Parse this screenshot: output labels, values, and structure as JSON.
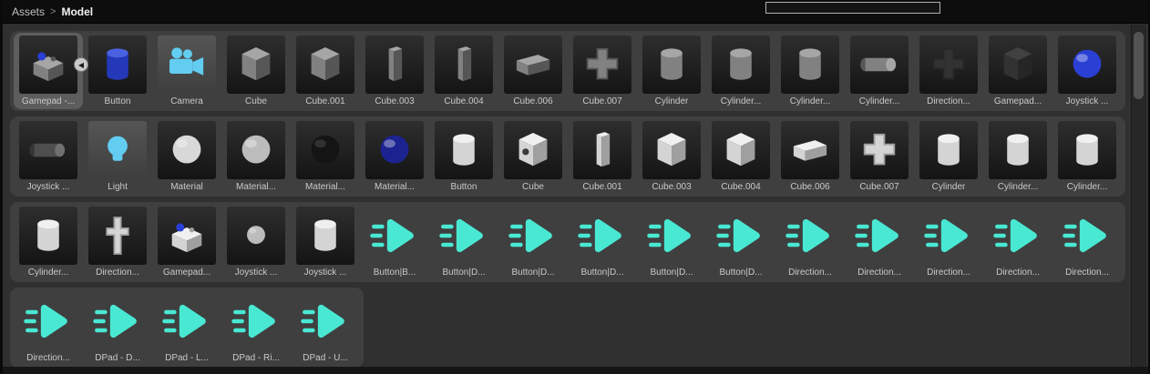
{
  "colors": {
    "accent_anim": "#49e8d3",
    "accent_cyan": "#63cdf1",
    "sphere_blue": "#2a3fd4",
    "selection": "#5d5d5d",
    "strip": "#3f3f3f",
    "page": "#303030",
    "header": "#0d0d0d",
    "label": "#c9c9c9"
  },
  "header": {
    "breadcrumb": [
      {
        "label": "Assets"
      },
      {
        "label": "Model"
      }
    ],
    "separator": ">",
    "search": {
      "value": "",
      "placeholder": ""
    }
  },
  "grid": {
    "rows": [
      {
        "items": [
          {
            "label": "Gamepad -...",
            "icon": "gamepad",
            "tone": "gray",
            "thumb": "dark",
            "selected": true,
            "badge": "◀"
          },
          {
            "label": "Button",
            "icon": "cylinder",
            "tone": "blue",
            "thumb": "dark"
          },
          {
            "label": "Camera",
            "icon": "camera",
            "thumb": "gray"
          },
          {
            "label": "Cube",
            "icon": "cube",
            "tone": "gray",
            "thumb": "dark"
          },
          {
            "label": "Cube.001",
            "icon": "cube",
            "tone": "gray",
            "thumb": "dark"
          },
          {
            "label": "Cube.003",
            "icon": "panel",
            "tone": "gray",
            "thumb": "dark"
          },
          {
            "label": "Cube.004",
            "icon": "panel",
            "tone": "gray",
            "thumb": "dark"
          },
          {
            "label": "Cube.006",
            "icon": "slab",
            "tone": "gray",
            "thumb": "dark"
          },
          {
            "label": "Cube.007",
            "icon": "cross",
            "tone": "gray",
            "thumb": "dark"
          },
          {
            "label": "Cylinder",
            "icon": "cylinder",
            "tone": "gray",
            "thumb": "dark"
          },
          {
            "label": "Cylinder...",
            "icon": "cylinder",
            "tone": "gray",
            "thumb": "dark"
          },
          {
            "label": "Cylinder...",
            "icon": "cylinder",
            "tone": "gray",
            "thumb": "dark"
          },
          {
            "label": "Cylinder...",
            "icon": "cylinder-h",
            "tone": "gray",
            "thumb": "dark"
          },
          {
            "label": "Direction...",
            "icon": "cross",
            "tone": "dark",
            "thumb": "dark"
          },
          {
            "label": "Gamepad...",
            "icon": "cube",
            "tone": "dark",
            "thumb": "dark"
          },
          {
            "label": "Joystick ...",
            "icon": "sphere",
            "tone": "blue",
            "thumb": "dark"
          }
        ]
      },
      {
        "items": [
          {
            "label": "Joystick ...",
            "icon": "cylinder-h",
            "tone": "darkgray",
            "thumb": "dark"
          },
          {
            "label": "Light",
            "icon": "light",
            "thumb": "gray"
          },
          {
            "label": "Material",
            "icon": "sphere",
            "tone": "light",
            "thumb": "dark"
          },
          {
            "label": "Material...",
            "icon": "sphere",
            "tone": "mid",
            "thumb": "dark"
          },
          {
            "label": "Material...",
            "icon": "sphere",
            "tone": "black",
            "thumb": "dark"
          },
          {
            "label": "Material...",
            "icon": "sphere",
            "tone": "darkblue",
            "thumb": "dark"
          },
          {
            "label": "Button",
            "icon": "cylinder",
            "tone": "white",
            "thumb": "dark"
          },
          {
            "label": "Cube",
            "icon": "cube-dot",
            "tone": "white",
            "thumb": "dark"
          },
          {
            "label": "Cube.001",
            "icon": "panel",
            "tone": "white",
            "thumb": "dark"
          },
          {
            "label": "Cube.003",
            "icon": "cube",
            "tone": "white",
            "thumb": "dark"
          },
          {
            "label": "Cube.004",
            "icon": "cube",
            "tone": "white",
            "thumb": "dark"
          },
          {
            "label": "Cube.006",
            "icon": "slab",
            "tone": "white",
            "thumb": "dark"
          },
          {
            "label": "Cube.007",
            "icon": "cross",
            "tone": "white",
            "thumb": "dark"
          },
          {
            "label": "Cylinder",
            "icon": "cylinder",
            "tone": "white",
            "thumb": "dark"
          },
          {
            "label": "Cylinder...",
            "icon": "cylinder",
            "tone": "white",
            "thumb": "dark"
          },
          {
            "label": "Cylinder...",
            "icon": "cylinder",
            "tone": "white",
            "thumb": "dark"
          }
        ]
      },
      {
        "items": [
          {
            "label": "Cylinder...",
            "icon": "cylinder",
            "tone": "white",
            "thumb": "dark"
          },
          {
            "label": "Direction...",
            "icon": "dircross",
            "tone": "white",
            "thumb": "dark"
          },
          {
            "label": "Gamepad...",
            "icon": "gamepad",
            "tone": "white",
            "thumb": "dark"
          },
          {
            "label": "Joystick ...",
            "icon": "sphere-small",
            "tone": "mid",
            "thumb": "dark"
          },
          {
            "label": "Joystick ...",
            "icon": "cylinder",
            "tone": "white",
            "thumb": "dark"
          },
          {
            "label": "Button|B...",
            "icon": "anim",
            "thumb": "none"
          },
          {
            "label": "Button|D...",
            "icon": "anim",
            "thumb": "none"
          },
          {
            "label": "Button|D...",
            "icon": "anim",
            "thumb": "none"
          },
          {
            "label": "Button|D...",
            "icon": "anim",
            "thumb": "none"
          },
          {
            "label": "Button|D...",
            "icon": "anim",
            "thumb": "none"
          },
          {
            "label": "Button|D...",
            "icon": "anim",
            "thumb": "none"
          },
          {
            "label": "Direction...",
            "icon": "anim",
            "thumb": "none"
          },
          {
            "label": "Direction...",
            "icon": "anim",
            "thumb": "none"
          },
          {
            "label": "Direction...",
            "icon": "anim",
            "thumb": "none"
          },
          {
            "label": "Direction...",
            "icon": "anim",
            "thumb": "none"
          },
          {
            "label": "Direction...",
            "icon": "anim",
            "thumb": "none"
          }
        ]
      },
      {
        "items": [
          {
            "label": "Direction...",
            "icon": "anim",
            "thumb": "none"
          },
          {
            "label": "DPad - D...",
            "icon": "anim",
            "thumb": "none"
          },
          {
            "label": "DPad - L...",
            "icon": "anim",
            "thumb": "none"
          },
          {
            "label": "DPad - Ri...",
            "icon": "anim",
            "thumb": "none"
          },
          {
            "label": "DPad - U...",
            "icon": "anim",
            "thumb": "none"
          }
        ]
      }
    ]
  }
}
